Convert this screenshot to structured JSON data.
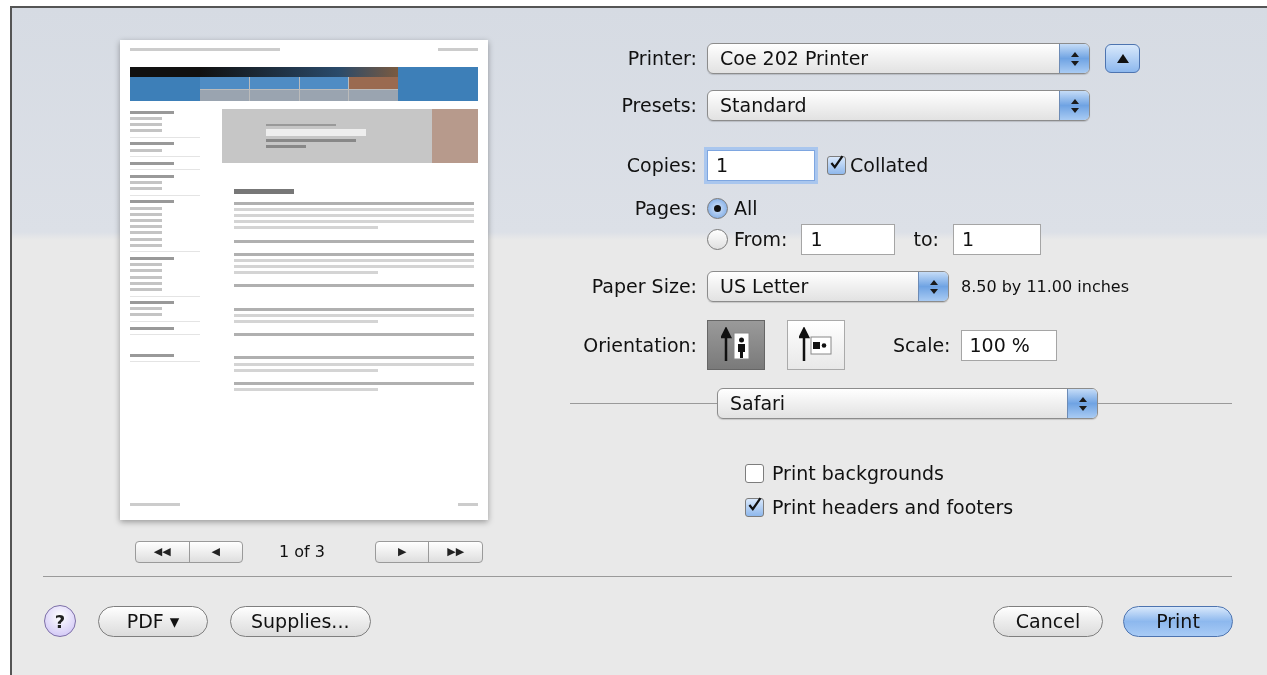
{
  "page_nav": {
    "back": [
      "◀◀",
      "◀"
    ],
    "indicator": "1 of 3",
    "forward": [
      "▶",
      "▶▶"
    ]
  },
  "printer": {
    "label": "Printer:",
    "value": "Coe 202 Printer"
  },
  "presets": {
    "label": "Presets:",
    "value": "Standard"
  },
  "copies": {
    "label": "Copies:",
    "value": "1"
  },
  "collated": {
    "label": "Collated",
    "checked": true
  },
  "pages": {
    "label": "Pages:",
    "options": [
      {
        "label": "All",
        "selected": true
      },
      {
        "label": "From:",
        "selected": false
      }
    ],
    "from": "1",
    "to_label": "to:",
    "to": "1"
  },
  "paper_size": {
    "label": "Paper Size:",
    "value": "US Letter",
    "dimensions": "8.50 by 11.00 inches"
  },
  "orientation": {
    "label": "Orientation:",
    "options": [
      {
        "kind": "portrait",
        "selected": true
      },
      {
        "kind": "landscape",
        "selected": false
      }
    ]
  },
  "scale": {
    "label": "Scale:",
    "value": "100 %"
  },
  "panel_menu": {
    "value": "Safari"
  },
  "options": [
    {
      "label": "Print backgrounds",
      "checked": false
    },
    {
      "label": "Print headers and footers",
      "checked": true
    }
  ],
  "left_buttons": [
    {
      "kind": "help",
      "label": "?"
    },
    {
      "kind": "plain",
      "label": "PDF ▾"
    },
    {
      "kind": "plain",
      "label": "Supplies..."
    }
  ],
  "right_buttons": [
    {
      "kind": "plain",
      "label": "Cancel"
    },
    {
      "kind": "default",
      "label": "Print"
    }
  ]
}
